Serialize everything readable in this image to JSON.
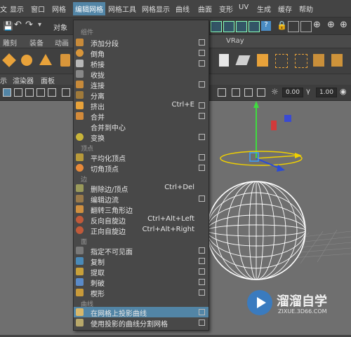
{
  "menubar": {
    "items": [
      "文",
      "显示",
      "窗口",
      "网格",
      "编辑网格",
      "网格工具",
      "网格显示",
      "曲线",
      "曲面",
      "变形",
      "UV",
      "生成",
      "缓存",
      "帮助"
    ],
    "active_index": 4
  },
  "toolbar": {
    "object_label": "对象"
  },
  "shelf_tabs": {
    "items": [
      "雕刻",
      "装备",
      "动画",
      "VRay"
    ]
  },
  "panel_menu": {
    "items": [
      "示",
      "渲染器",
      "面板"
    ]
  },
  "panel_toolbar": {
    "field1": "0.00",
    "field2": "1.00"
  },
  "dropdown": {
    "section_component": "组件",
    "items_component": [
      {
        "label": "添加分段",
        "shortcut": "",
        "option": true
      },
      {
        "label": "倒角",
        "shortcut": "",
        "option": true
      },
      {
        "label": "桥接",
        "shortcut": "",
        "option": true
      },
      {
        "label": "收拢",
        "shortcut": "",
        "option": false
      },
      {
        "label": "连接",
        "shortcut": "",
        "option": true
      },
      {
        "label": "分离",
        "shortcut": "",
        "option": false
      },
      {
        "label": "挤出",
        "shortcut": "Ctrl+E",
        "option": true
      },
      {
        "label": "合并",
        "shortcut": "",
        "option": true
      },
      {
        "label": "合并到中心",
        "shortcut": "",
        "option": false
      },
      {
        "label": "变换",
        "shortcut": "",
        "option": true
      }
    ],
    "section_vertex": "顶点",
    "items_vertex": [
      {
        "label": "平均化顶点",
        "shortcut": "",
        "option": true
      },
      {
        "label": "切角顶点",
        "shortcut": "",
        "option": true
      }
    ],
    "section_edge": "边",
    "items_edge": [
      {
        "label": "删除边/顶点",
        "shortcut": "Ctrl+Del",
        "option": false
      },
      {
        "label": "编辑边流",
        "shortcut": "",
        "option": true
      },
      {
        "label": "翻转三角形边",
        "shortcut": "",
        "option": false
      },
      {
        "label": "反向自旋边",
        "shortcut": "Ctrl+Alt+Left",
        "option": false
      },
      {
        "label": "正向自旋边",
        "shortcut": "Ctrl+Alt+Right",
        "option": false
      }
    ],
    "section_face": "面",
    "items_face": [
      {
        "label": "指定不可见面",
        "shortcut": "",
        "option": true
      },
      {
        "label": "复制",
        "shortcut": "",
        "option": true
      },
      {
        "label": "提取",
        "shortcut": "",
        "option": true
      },
      {
        "label": "刺破",
        "shortcut": "",
        "option": true
      },
      {
        "label": "楔形",
        "shortcut": "",
        "option": true
      }
    ],
    "section_curve": "曲线",
    "items_curve": [
      {
        "label": "在网格上投影曲线",
        "shortcut": "",
        "option": true,
        "highlighted": true
      },
      {
        "label": "使用投影的曲线分割网格",
        "shortcut": "",
        "option": true
      }
    ]
  },
  "watermark": {
    "title": "溜溜自学",
    "url": "ZIXUE.3D66.COM"
  },
  "colors": {
    "highlight": "#5285a6",
    "menu_bg": "#484848",
    "viewport": "#6f6f6f"
  }
}
